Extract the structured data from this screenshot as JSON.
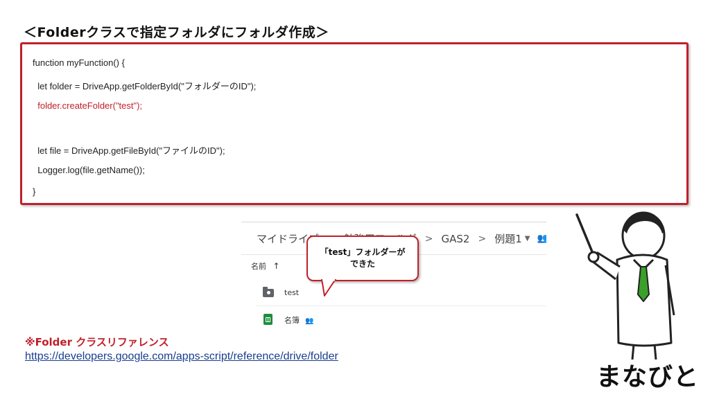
{
  "slide": {
    "title": "＜Folderクラスで指定フォルダにフォルダ作成＞"
  },
  "code": {
    "lines": [
      "function myFunction() {",
      "  let folder = DriveApp.getFolderById(\"フォルダーのID\");",
      "  folder.createFolder(\"test\");",
      "",
      "  let file = DriveApp.getFileById(\"ファイルのID\");",
      "  Logger.log(file.getName());",
      "}"
    ],
    "highlight_color": "#c0202a"
  },
  "drive": {
    "breadcrumbs": [
      "マイドライブ",
      "勉強用フォルダ",
      "GAS2",
      "例題1"
    ],
    "sort_header": "名前",
    "rows": [
      {
        "name": "test",
        "icon": "folder-icon"
      },
      {
        "name": "名簿",
        "icon": "sheets-icon"
      }
    ]
  },
  "bubble": {
    "text": "「test」フォルダーが\nできた"
  },
  "reference": {
    "heading": "※Folder クラスリファレンス",
    "url": "https://developers.google.com/apps-script/reference/drive/folder"
  },
  "logo": {
    "text": "まなびと"
  },
  "colors": {
    "accent_red": "#c0202a",
    "link_blue": "#1a3d8f",
    "tie_green": "#3aa02a"
  }
}
